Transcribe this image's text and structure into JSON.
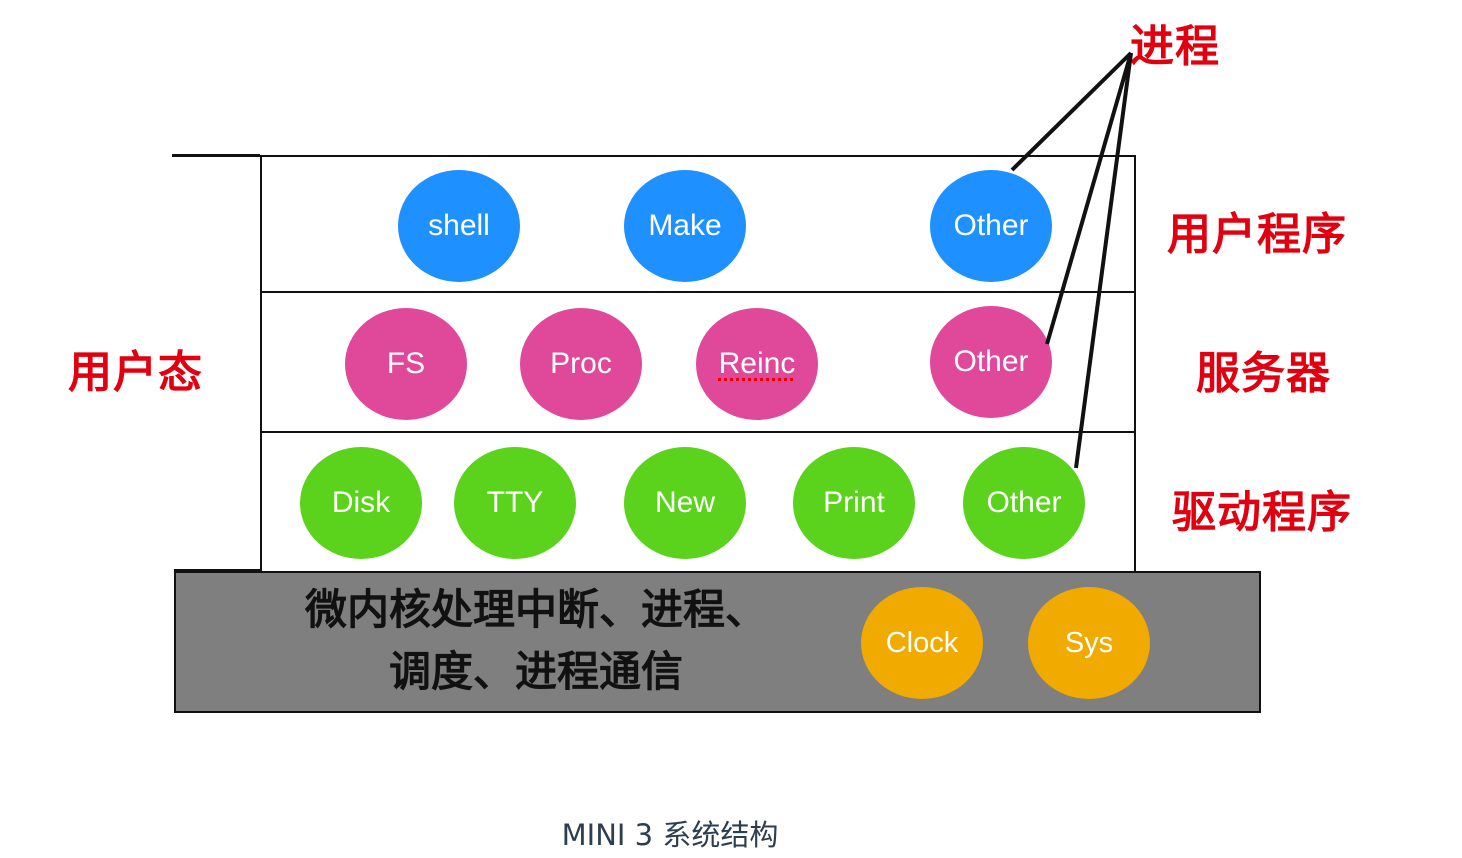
{
  "diagram": {
    "caption": "MINI 3 系统结构",
    "annotation_label": "进程",
    "mode_label": "用户态",
    "layers": [
      {
        "id": "user",
        "label": "用户程序",
        "color": "#1e90ff",
        "nodes": [
          "shell",
          "Make",
          "Other"
        ]
      },
      {
        "id": "server",
        "label": "服务器",
        "color": "#e0489a",
        "nodes": [
          "FS",
          "Proc",
          "Reinc",
          "Other"
        ]
      },
      {
        "id": "driver",
        "label": "驱动程序",
        "color": "#5bd31c",
        "nodes": [
          "Disk",
          "TTY",
          "New",
          "Print",
          "Other"
        ]
      }
    ],
    "kernel": {
      "text_line1": "微内核处理中断、进程、",
      "text_line2": "调度、进程通信",
      "color": "#7f7f7f",
      "node_color": "#f0aa00",
      "nodes": [
        "Clock",
        "Sys"
      ]
    },
    "label_color": "#e0000f"
  }
}
